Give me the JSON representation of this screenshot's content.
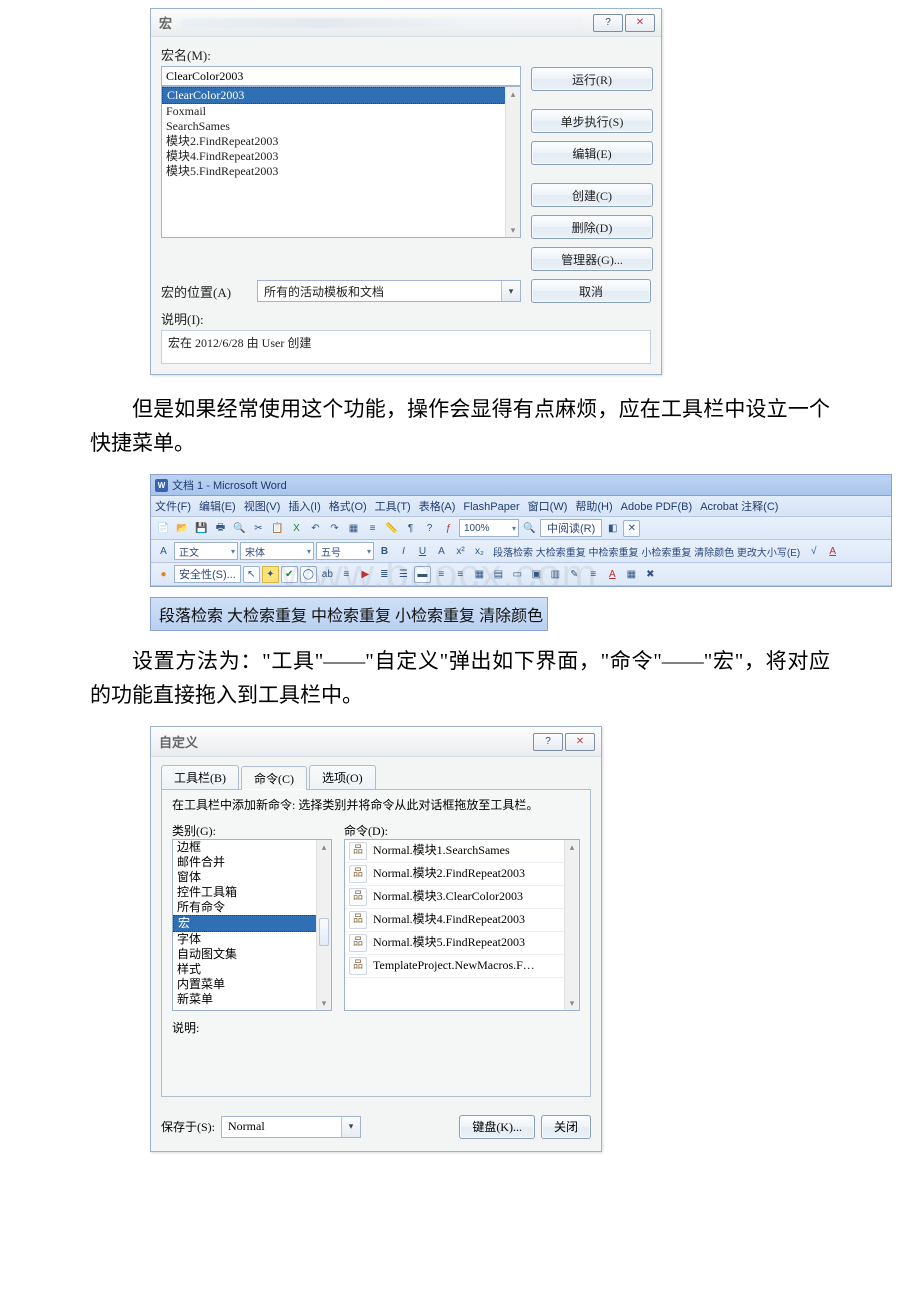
{
  "dlg1": {
    "title": "宏",
    "help_glyph": "?",
    "close_glyph": "✕",
    "name_label": "宏名(M):",
    "name_value": "ClearColor2003",
    "list": [
      "ClearColor2003",
      "Foxmail",
      "SearchSames",
      "模块2.FindRepeat2003",
      "模块4.FindRepeat2003",
      "模块5.FindRepeat2003"
    ],
    "btn_run": "运行(R)",
    "btn_step": "单步执行(S)",
    "btn_edit": "编辑(E)",
    "btn_create": "创建(C)",
    "btn_delete": "删除(D)",
    "btn_manager": "管理器(G)...",
    "btn_cancel": "取消",
    "loc_label": "宏的位置(A)",
    "loc_value": "所有的活动模板和文档",
    "desc_label": "说明(I):",
    "desc_value": "宏在 2012/6/28 由 User 创建"
  },
  "para1": "但是如果经常使用这个功能，操作会显得有点麻烦，应在工具栏中设立一个快捷菜单。",
  "word": {
    "title_text": "文档 1 - Microsoft Word",
    "menus": [
      "文件(F)",
      "编辑(E)",
      "视图(V)",
      "插入(I)",
      "格式(O)",
      "工具(T)",
      "表格(A)",
      "FlashPaper",
      "窗口(W)",
      "帮助(H)",
      "Adobe PDF(B)",
      "Acrobat 注释(C)"
    ],
    "row1_sel1": "正文",
    "row1_sel2": "宋体",
    "row1_sel3": "五号",
    "row1_zoom": "100%",
    "row1_btn_read": "中阅读(R)",
    "row1_text_group": "段落检索 大检索重复 中检索重复 小检索重复 清除颜色 更改大小写(E)",
    "row2_sec": "安全性(S)..."
  },
  "strip": {
    "items": [
      "段落检索",
      "大检索重复",
      "中检索重复",
      "小检索重复",
      "清除颜色"
    ]
  },
  "para2": "设置方法为：\"工具\"——\"自定义\"弹出如下界面，\"命令\"——\"宏\"，将对应的功能直接拖入到工具栏中。",
  "dlg2": {
    "title": "自定义",
    "help_glyph": "?",
    "close_glyph": "✕",
    "tabs": {
      "toolbars": "工具栏(B)",
      "commands": "命令(C)",
      "options": "选项(O)"
    },
    "hint": "在工具栏中添加新命令: 选择类别并将命令从此对话框拖放至工具栏。",
    "cat_label": "类别(G):",
    "cmd_label": "命令(D):",
    "categories": [
      "边框",
      "邮件合并",
      "窗体",
      "控件工具箱",
      "所有命令",
      "宏",
      "字体",
      "自动图文集",
      "样式",
      "内置菜单",
      "新菜单"
    ],
    "selected_category_index": 5,
    "commands": [
      "Normal.模块1.SearchSames",
      "Normal.模块2.FindRepeat2003",
      "Normal.模块3.ClearColor2003",
      "Normal.模块4.FindRepeat2003",
      "Normal.模块5.FindRepeat2003",
      "TemplateProject.NewMacros.F…"
    ],
    "desc_label": "说明:",
    "save_label": "保存于(S):",
    "save_value": "Normal",
    "btn_keyboard": "键盘(K)...",
    "btn_close": "关闭"
  }
}
